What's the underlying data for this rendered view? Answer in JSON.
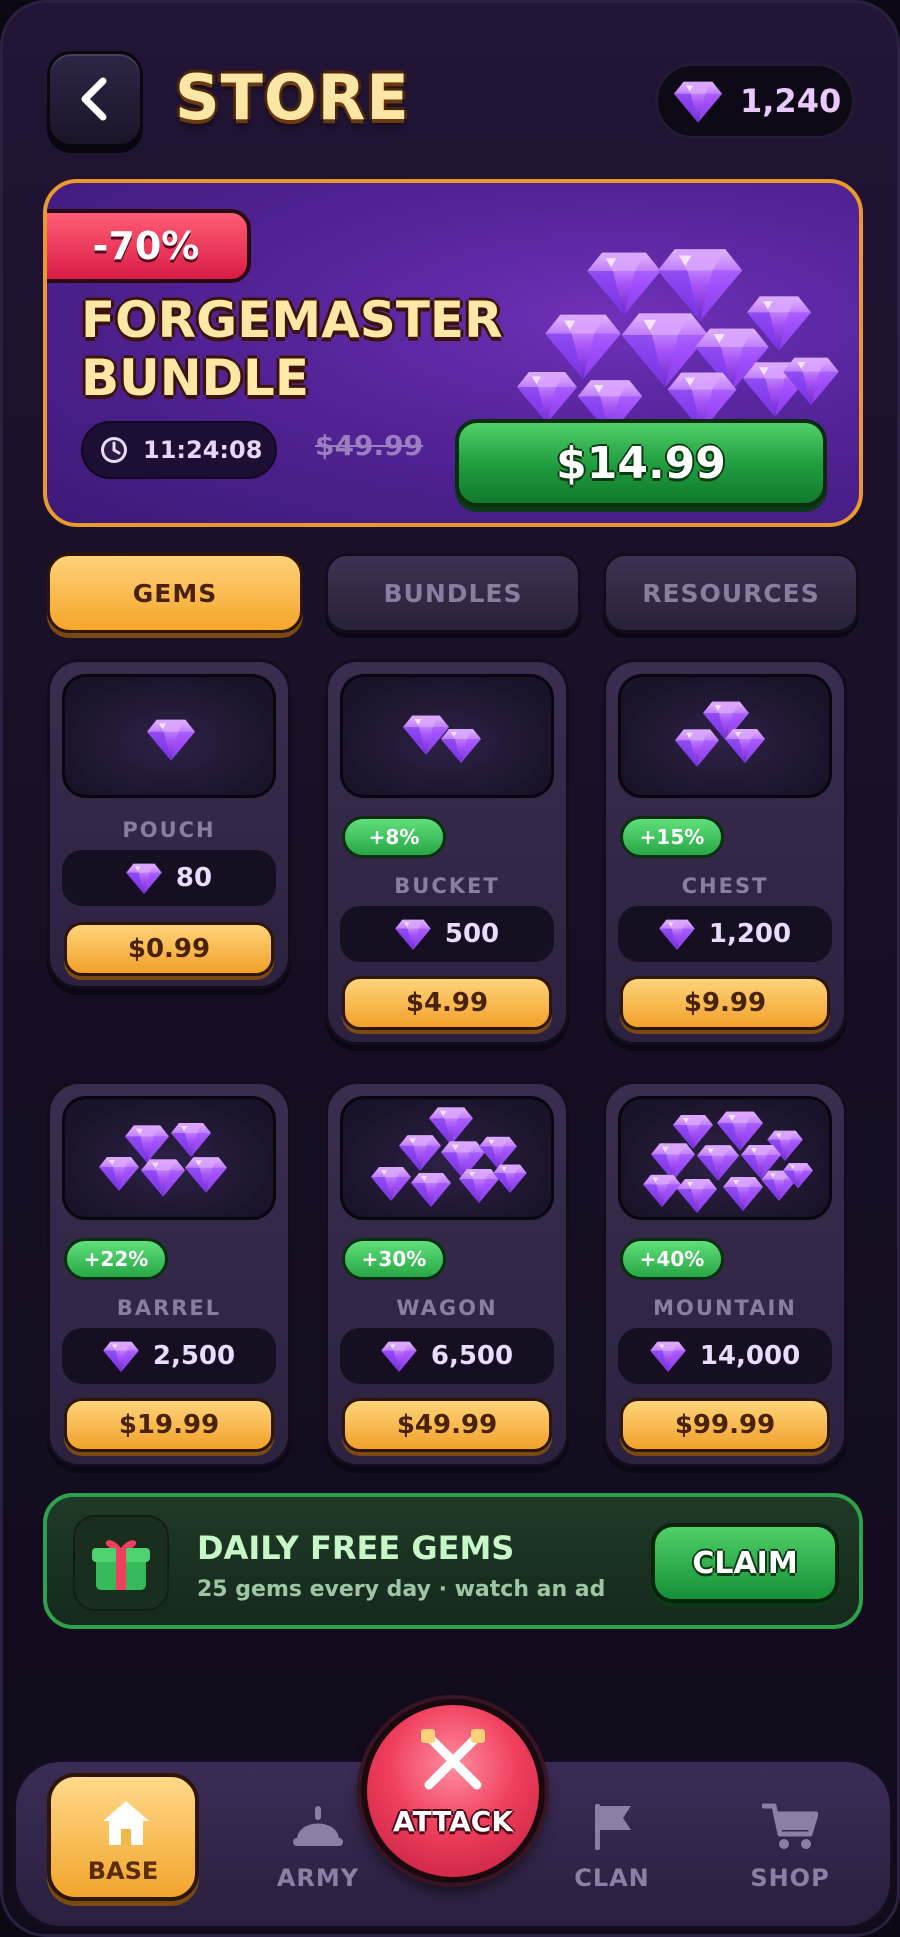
{
  "header": {
    "title": "STORE",
    "gem_balance": "1,240"
  },
  "offer": {
    "discount": "-70%",
    "name_line1": "FORGEMASTER",
    "name_line2": "BUNDLE",
    "timer": "11:24:08",
    "old_price": "$49.99",
    "price": "$14.99"
  },
  "tabs": [
    {
      "label": "GEMS",
      "active": true
    },
    {
      "label": "BUNDLES",
      "active": false
    },
    {
      "label": "RESOURCES",
      "active": false
    }
  ],
  "packs": [
    {
      "name": "POUCH",
      "bonus": "",
      "amount": "80",
      "price": "$0.99"
    },
    {
      "name": "BUCKET",
      "bonus": "+8%",
      "amount": "500",
      "price": "$4.99"
    },
    {
      "name": "CHEST",
      "bonus": "+15%",
      "amount": "1,200",
      "price": "$9.99"
    },
    {
      "name": "BARREL",
      "bonus": "+22%",
      "amount": "2,500",
      "price": "$19.99"
    },
    {
      "name": "WAGON",
      "bonus": "+30%",
      "amount": "6,500",
      "price": "$49.99"
    },
    {
      "name": "MOUNTAIN",
      "bonus": "+40%",
      "amount": "14,000",
      "price": "$99.99"
    }
  ],
  "daily": {
    "title": "DAILY FREE GEMS",
    "subtitle": "25 gems every day · watch an ad",
    "button": "CLAIM"
  },
  "nav": {
    "base": "BASE",
    "army": "ARMY",
    "attack": "ATTACK",
    "clan": "CLAN",
    "shop": "SHOP"
  },
  "colors": {
    "gem": "#a855f7",
    "accent_gold": "#f5a52a",
    "accent_green": "#27a745",
    "attack_red": "#f0405e"
  }
}
